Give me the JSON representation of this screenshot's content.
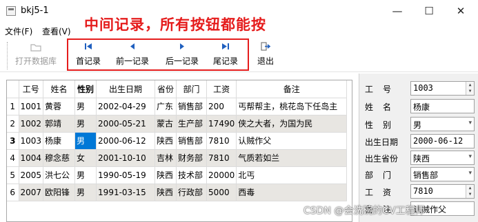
{
  "window": {
    "title": "bkj5-1",
    "minimize": "—",
    "maximize": "☐",
    "close": "✕"
  },
  "menu": [
    {
      "label": "文件(F)"
    },
    {
      "label": "查看(V)"
    }
  ],
  "annotation": "中间记录，所有按钮都能按",
  "toolbar": {
    "open_db": "打开数据库",
    "first": "首记录",
    "prev": "前一记录",
    "next": "后一记录",
    "last": "尾记录",
    "exit": "退出"
  },
  "table": {
    "headers": [
      "工号",
      "姓名",
      "性别",
      "出生日期",
      "省份",
      "部门",
      "工资",
      "备注"
    ],
    "rows": [
      {
        "num": "1",
        "cells": [
          "1001",
          "黄蓉",
          "男",
          "2002-04-29",
          "广东",
          "销售部",
          "200",
          "丐帮帮主，桃花岛下任岛主"
        ]
      },
      {
        "num": "2",
        "cells": [
          "1002",
          "郭靖",
          "男",
          "2000-05-21",
          "蒙古",
          "生产部",
          "17490",
          "侠之大者，为国为民"
        ]
      },
      {
        "num": "3",
        "cells": [
          "1003",
          "杨康",
          "男",
          "2000-06-12",
          "陕西",
          "销售部",
          "7810",
          "认贼作父"
        ]
      },
      {
        "num": "4",
        "cells": [
          "1004",
          "穆念慈",
          "女",
          "2001-10-10",
          "吉林",
          "财务部",
          "7810",
          "气质若如兰"
        ]
      },
      {
        "num": "5",
        "cells": [
          "2005",
          "洪七公",
          "男",
          "1990-05-19",
          "陕西",
          "技术部",
          "20000",
          "北丐"
        ]
      },
      {
        "num": "6",
        "cells": [
          "2007",
          "欧阳锋",
          "男",
          "1991-03-15",
          "陕西",
          "行政部",
          "5000",
          "西毒"
        ]
      }
    ],
    "current_row": "3",
    "selected_cell": "性别"
  },
  "form": {
    "labels": {
      "id": "工号",
      "name": "姓名",
      "gender": "性别",
      "birth": "出生日期",
      "province": "出生省份",
      "dept": "部门",
      "salary": "工资",
      "note": "备注"
    },
    "values": {
      "id": "1003",
      "name": "杨康",
      "gender": "男",
      "birth": "2000-06-12",
      "province": "陕西",
      "dept": "销售部",
      "salary": "7810",
      "note": "认贼作父"
    }
  },
  "watermark": "CSDN @会洗碗的CV工程师",
  "colors": {
    "annotation": "#e51c1c",
    "selection": "#0078d7",
    "alt_row": "#e8e6e2",
    "toolbar_icon": "#1f5fbf"
  }
}
